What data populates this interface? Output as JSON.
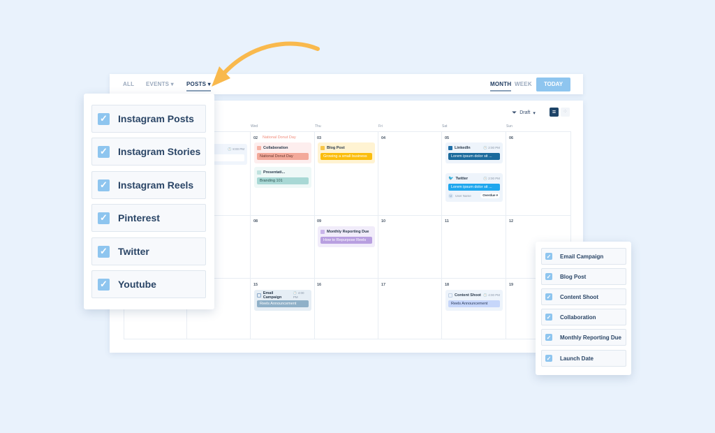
{
  "tabs": [
    {
      "label": "ALL"
    },
    {
      "label": "EVENTS"
    },
    {
      "label": "POSTS"
    }
  ],
  "view": {
    "month": "MONTH",
    "week": "WEEK",
    "today": "TODAY"
  },
  "filter": {
    "label": "Draft"
  },
  "days": [
    "Wed",
    "Thu",
    "Fri",
    "Sat",
    "Sun"
  ],
  "holiday": "National Donut Day",
  "dates": [
    "02",
    "03",
    "04",
    "05",
    "06",
    "08",
    "09",
    "10",
    "11",
    "12",
    "15",
    "16",
    "17",
    "18",
    "19"
  ],
  "events": {
    "launch": {
      "time": "8:00 PM",
      "body": "Launch"
    },
    "collab": {
      "title": "Collaboration",
      "body": "National Donut Day"
    },
    "present": {
      "title": "Presentati...",
      "body": "Branding 101"
    },
    "blog": {
      "title": "Blog Post",
      "body": "Growing a small business"
    },
    "linkedin": {
      "title": "LinkedIn",
      "time": "2:00 PM",
      "body": "Lorem ipsum dolor sit ..."
    },
    "twitter": {
      "title": "Twitter",
      "time": "2:00 PM",
      "body": "Lorem ipsum dolor sit ...",
      "user": "User Name",
      "status": "Overdue",
      "avatar": "U"
    },
    "monthly": {
      "title": "Monthly Reporting Due",
      "body": "How to Repurpose Reels"
    },
    "email": {
      "title": "Email Campaign",
      "time": "4:00 PM",
      "body": "Reels Announcement"
    },
    "shoot": {
      "title": "Content Shoot",
      "time": "4:00 PM",
      "body": "Reels Announcement"
    }
  },
  "posts_menu": [
    {
      "label": "Instagram Posts",
      "checked": true
    },
    {
      "label": "Instagram Stories",
      "checked": true
    },
    {
      "label": "Instagram Reels",
      "checked": true
    },
    {
      "label": "Pinterest",
      "checked": true
    },
    {
      "label": "Twitter",
      "checked": true
    },
    {
      "label": "Youtube",
      "checked": true
    }
  ],
  "events_menu": [
    {
      "label": "Email Campaign",
      "checked": true
    },
    {
      "label": "Blog Post",
      "checked": true
    },
    {
      "label": "Content Shoot",
      "checked": true
    },
    {
      "label": "Collaboration",
      "checked": true
    },
    {
      "label": "Monthly Reporting Due",
      "checked": true
    },
    {
      "label": "Launch Date",
      "checked": true
    }
  ],
  "colors": {
    "accent": "#8ec5ef",
    "arrow": "#f9b94d",
    "holiday": "#f08c7c"
  }
}
